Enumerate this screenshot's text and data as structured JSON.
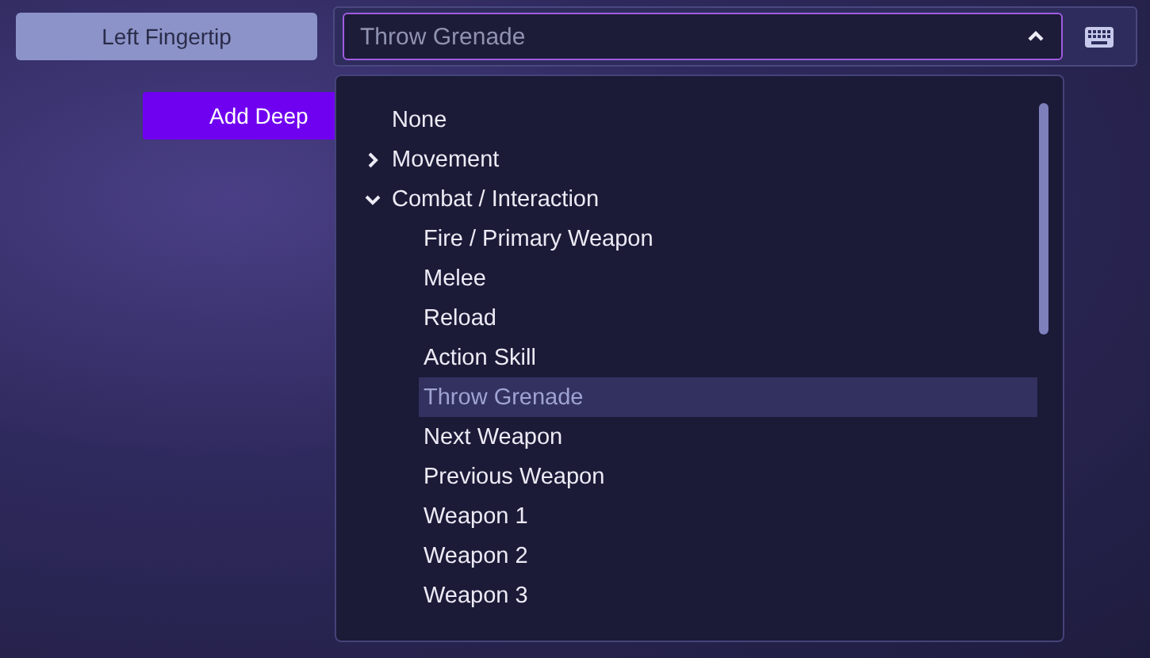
{
  "left_button": {
    "label": "Left Fingertip"
  },
  "add_button": {
    "label": "Add Deep"
  },
  "binding_select": {
    "value": "Throw Grenade",
    "expanded": true
  },
  "dropdown": {
    "options": [
      {
        "kind": "option",
        "label": "None",
        "selected": false
      },
      {
        "kind": "group",
        "label": "Movement",
        "expanded": false
      },
      {
        "kind": "group",
        "label": "Combat / Interaction",
        "expanded": true,
        "children": [
          {
            "kind": "option",
            "label": "Fire / Primary Weapon",
            "selected": false
          },
          {
            "kind": "option",
            "label": "Melee",
            "selected": false
          },
          {
            "kind": "option",
            "label": "Reload",
            "selected": false
          },
          {
            "kind": "option",
            "label": "Action Skill",
            "selected": false
          },
          {
            "kind": "option",
            "label": "Throw Grenade",
            "selected": true
          },
          {
            "kind": "option",
            "label": "Next Weapon",
            "selected": false
          },
          {
            "kind": "option",
            "label": "Previous Weapon",
            "selected": false
          },
          {
            "kind": "option",
            "label": "Weapon 1",
            "selected": false
          },
          {
            "kind": "option",
            "label": "Weapon 2",
            "selected": false
          },
          {
            "kind": "option",
            "label": "Weapon 3",
            "selected": false
          }
        ]
      }
    ]
  }
}
